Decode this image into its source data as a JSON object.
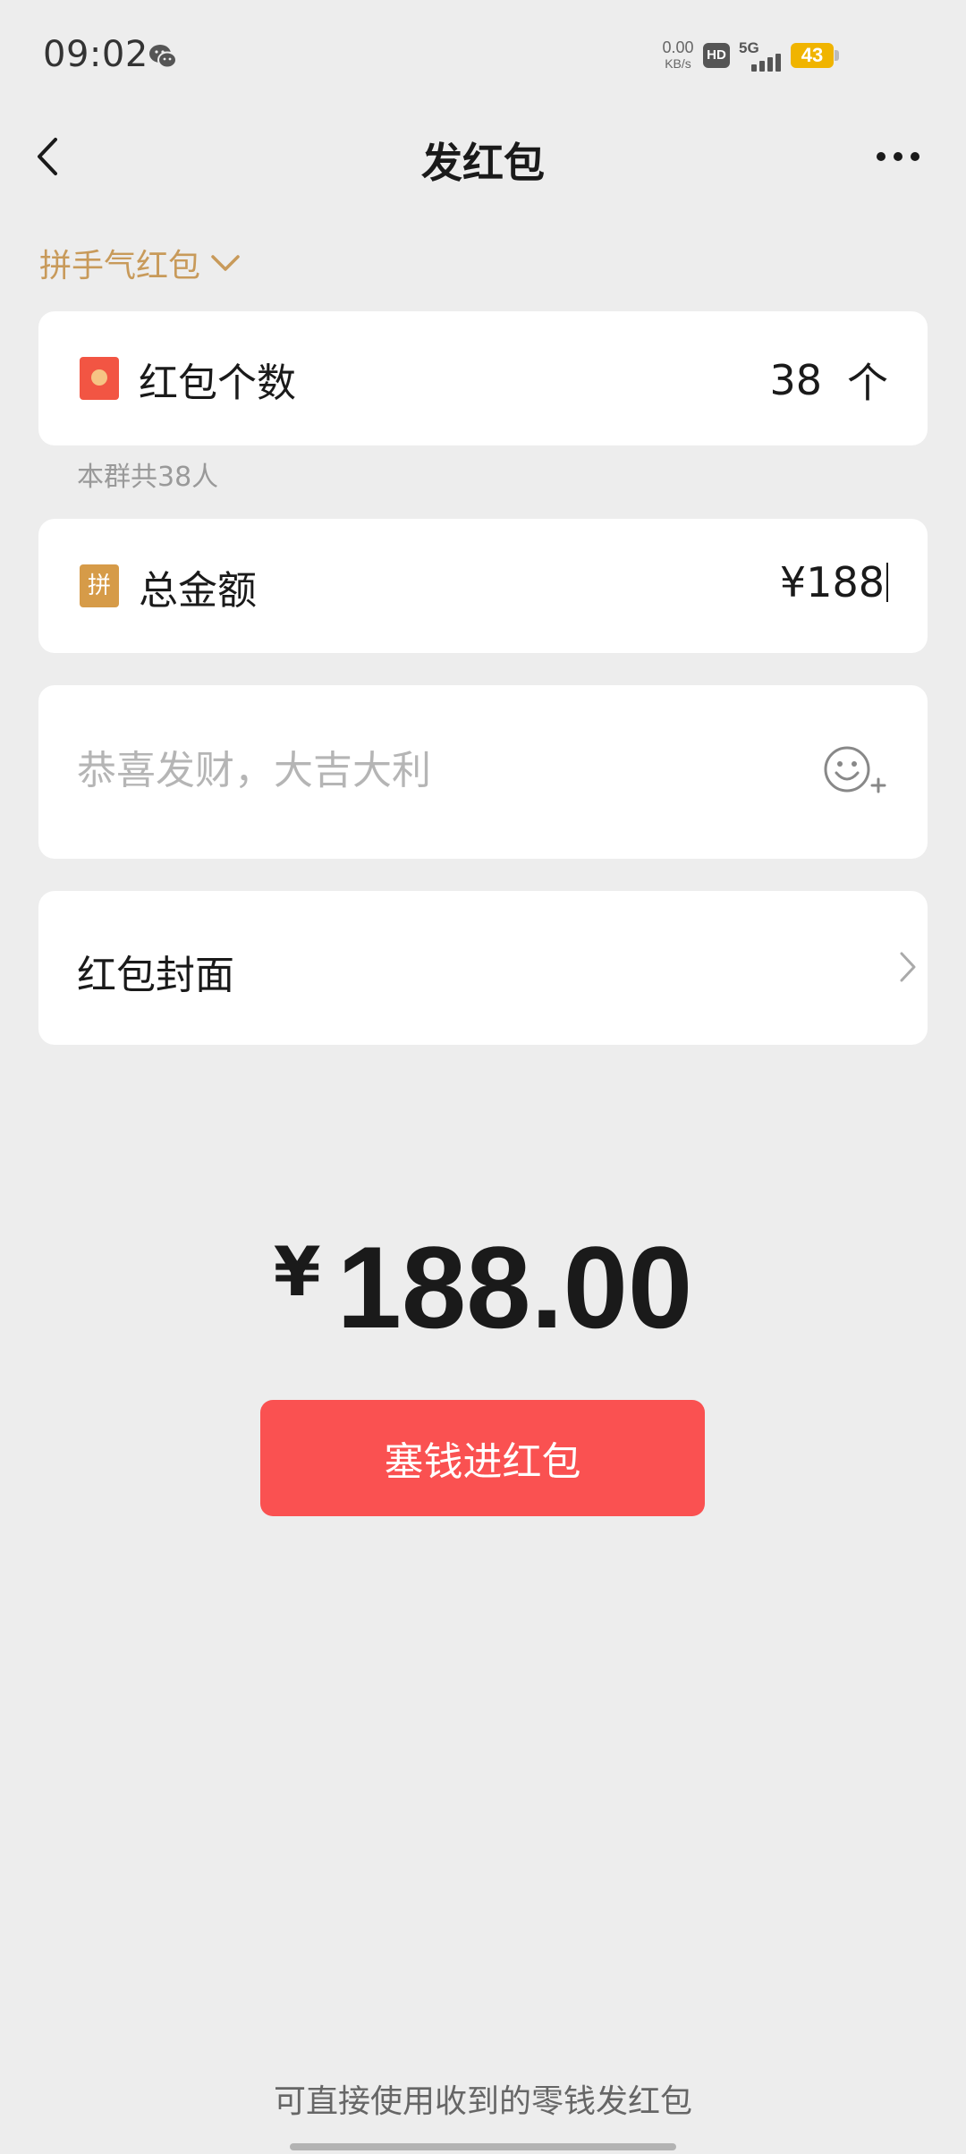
{
  "status_bar": {
    "time": "09:02",
    "app_icon": "wechat-icon",
    "net_speed_value": "0.00",
    "net_speed_unit": "KB/s",
    "hd_label": "HD",
    "network_label": "5G",
    "battery_level": "43",
    "battery_color": "#f0b400"
  },
  "nav": {
    "title": "发红包",
    "back_icon": "chevron-left-icon",
    "more_icon": "more-dots-icon"
  },
  "packet_type": {
    "label": "拼手气红包",
    "icon": "chevron-down-icon"
  },
  "count_row": {
    "icon": "red-packet-icon",
    "label": "红包个数",
    "value": "38",
    "unit": "个",
    "hint": "本群共38人"
  },
  "amount_row": {
    "icon_text": "拼",
    "label": "总金额",
    "value": "¥188"
  },
  "greeting": {
    "placeholder": "恭喜发财，大吉大利",
    "value": "",
    "icon": "emoji-add-icon"
  },
  "cover_row": {
    "label": "红包封面",
    "icon": "chevron-right-icon"
  },
  "total": {
    "currency": "¥",
    "amount": "188.00"
  },
  "submit": {
    "label": "塞钱进红包",
    "color": "#fa5151"
  },
  "footer": {
    "note": "可直接使用收到的零钱发红包"
  },
  "colors": {
    "background": "#ededed",
    "accent_gold": "#c89a5a",
    "packet_red": "#f25543"
  }
}
